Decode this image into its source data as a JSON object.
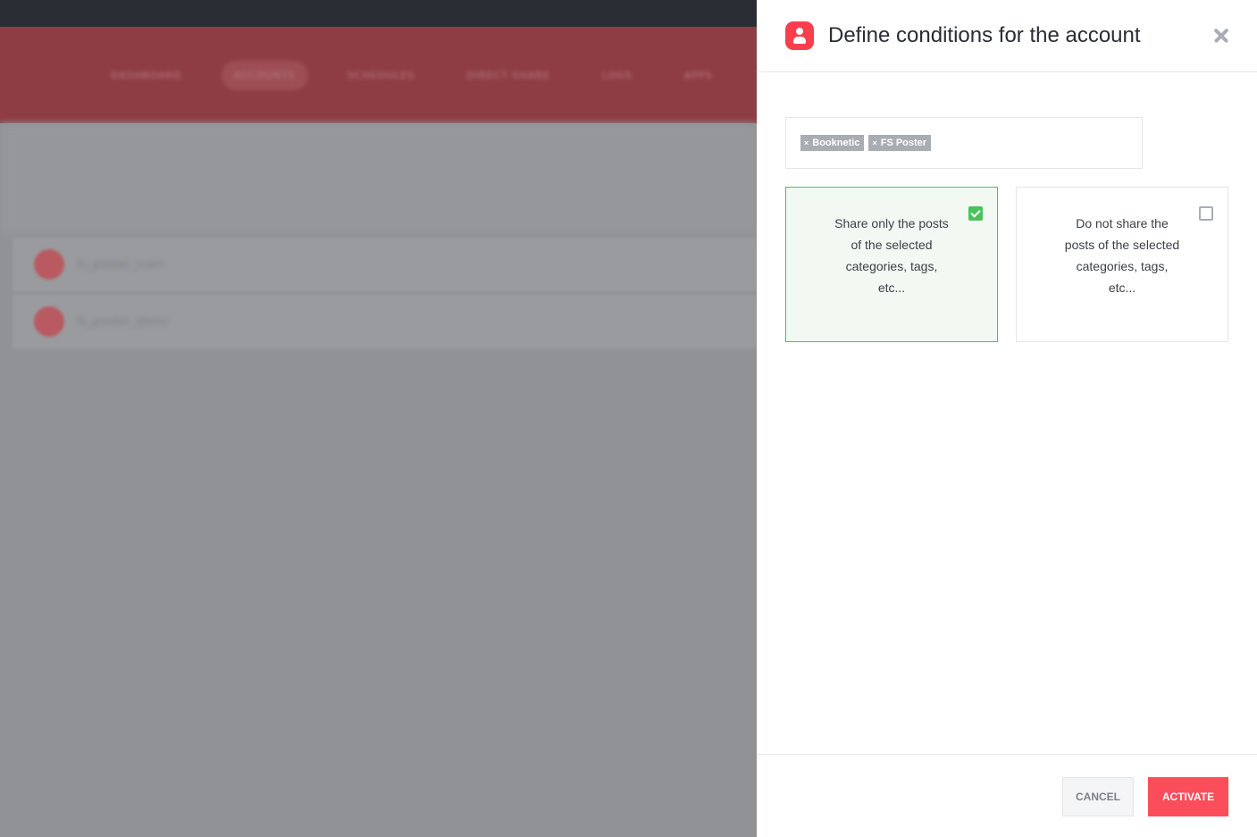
{
  "background": {
    "nav_items": [
      "DASHBOARD",
      "ACCOUNTS",
      "SCHEDULES",
      "DIRECT SHARE",
      "LOGS",
      "APPS"
    ],
    "active_nav_index": 1,
    "accounts": [
      "fs_poster_main",
      "fs_poster_demo"
    ]
  },
  "panel": {
    "title": "Define conditions for the account",
    "header_icon": "user-icon",
    "close_icon": "close-icon",
    "tags": [
      {
        "remove": "×",
        "label": "Booknetic"
      },
      {
        "remove": "×",
        "label": "FS Poster"
      }
    ],
    "options": [
      {
        "text": "Share only the posts of the selected categories, tags, etc...",
        "checked": true
      },
      {
        "text": "Do not share the posts of the selected categories, tags, etc...",
        "checked": false
      }
    ],
    "cancel_label": "CANCEL",
    "activate_label": "ACTIVATE"
  },
  "colors": {
    "accent": "#fb4e5a",
    "selected": "#49c25d"
  }
}
